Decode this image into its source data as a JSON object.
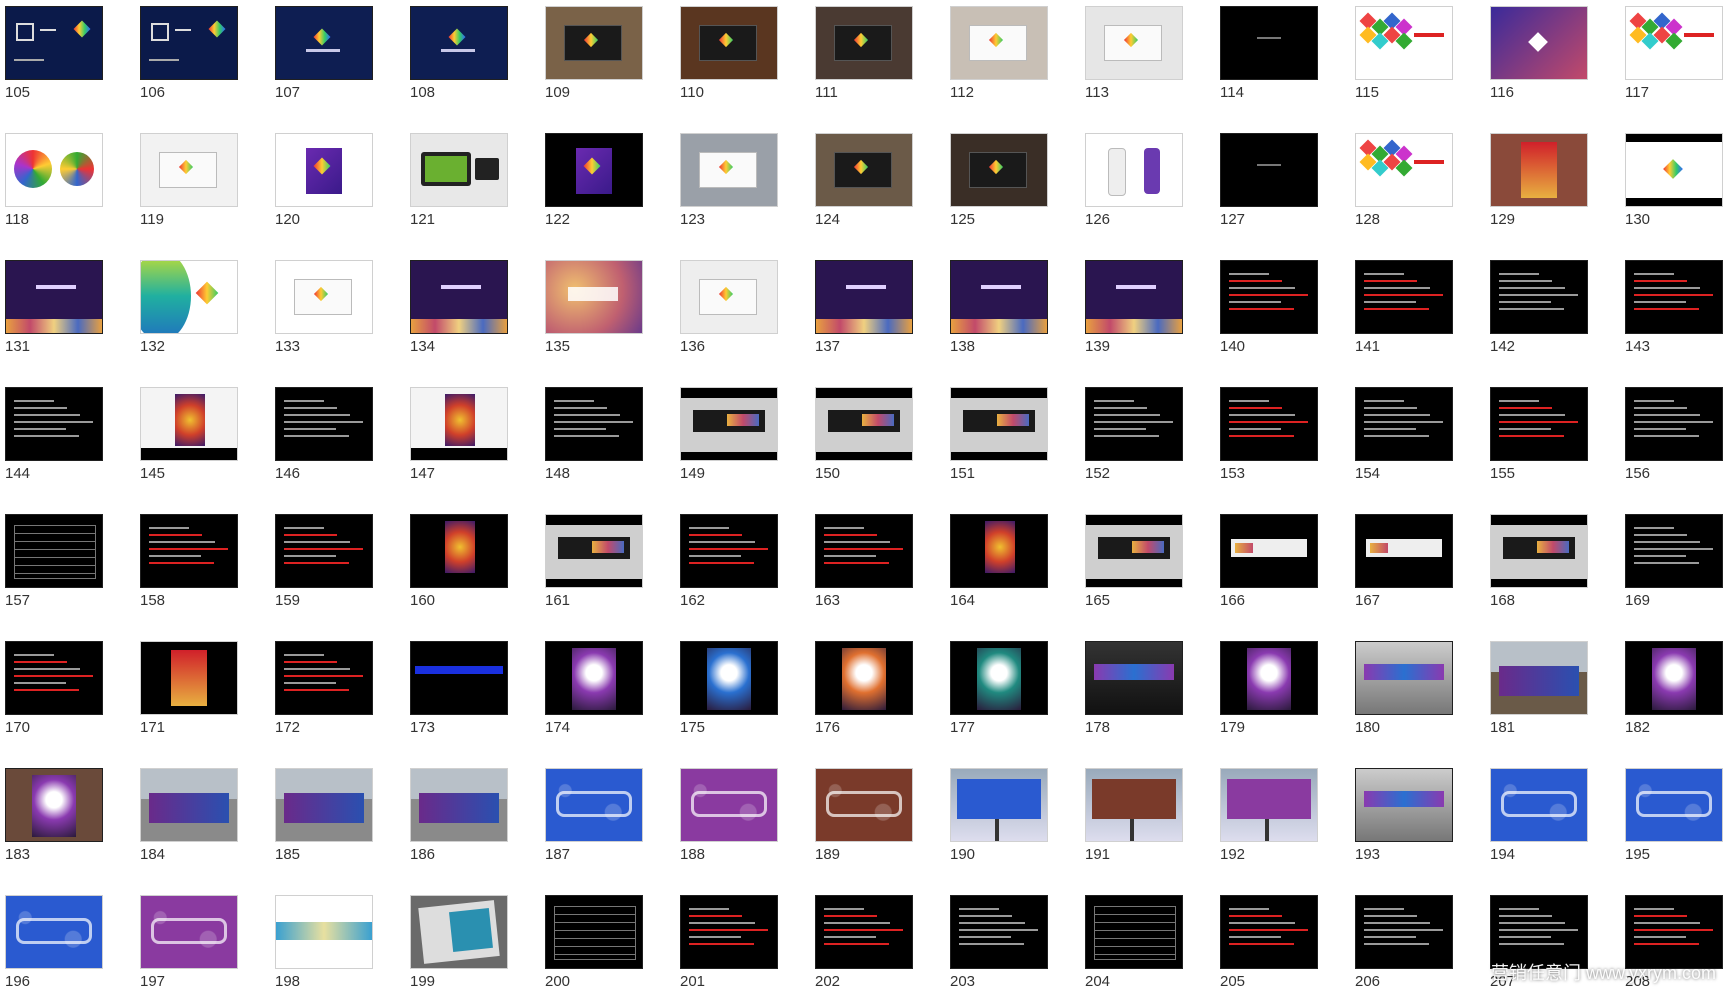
{
  "slides": [
    {
      "n": "105",
      "bg": "#0b1a4a",
      "style": "brand-dark"
    },
    {
      "n": "106",
      "bg": "#0b1a4a",
      "style": "brand-dark"
    },
    {
      "n": "107",
      "bg": "#0e1e52",
      "style": "navy"
    },
    {
      "n": "108",
      "bg": "#0e1e52",
      "style": "navy-logo"
    },
    {
      "n": "109",
      "bg": "#7a6248",
      "style": "photo-brown"
    },
    {
      "n": "110",
      "bg": "#5a3620",
      "style": "photo-brown"
    },
    {
      "n": "111",
      "bg": "#4a3a32",
      "style": "photo-brown"
    },
    {
      "n": "112",
      "bg": "#c8bfb5",
      "style": "photo-light"
    },
    {
      "n": "113",
      "bg": "#e6e6e6",
      "style": "photo-light"
    },
    {
      "n": "114",
      "bg": "#000000",
      "style": "black"
    },
    {
      "n": "115",
      "bg": "#ffffff",
      "style": "diamonds"
    },
    {
      "n": "116",
      "bg": "#5a3aa0",
      "style": "gradient"
    },
    {
      "n": "117",
      "bg": "#ffffff",
      "style": "diamonds"
    },
    {
      "n": "118",
      "bg": "#ffffff",
      "style": "umbrellas"
    },
    {
      "n": "119",
      "bg": "#f2f2f2",
      "style": "photo-light"
    },
    {
      "n": "120",
      "bg": "#ffffff",
      "style": "bag"
    },
    {
      "n": "121",
      "bg": "#e8e8e8",
      "style": "tablet"
    },
    {
      "n": "122",
      "bg": "#000000",
      "style": "bag-dark"
    },
    {
      "n": "123",
      "bg": "#9aa0a8",
      "style": "photo-light"
    },
    {
      "n": "124",
      "bg": "#6b5a48",
      "style": "photo-brown"
    },
    {
      "n": "125",
      "bg": "#3a2e26",
      "style": "photo-brown"
    },
    {
      "n": "126",
      "bg": "#ffffff",
      "style": "bottles"
    },
    {
      "n": "127",
      "bg": "#000000",
      "style": "black"
    },
    {
      "n": "128",
      "bg": "#ffffff",
      "style": "diamonds"
    },
    {
      "n": "129",
      "bg": "#8a4a3a",
      "style": "photo-red"
    },
    {
      "n": "130",
      "bg": "#ffffff",
      "style": "white-band"
    },
    {
      "n": "131",
      "bg": "#2a1550",
      "style": "purple-city"
    },
    {
      "n": "132",
      "bg": "#ffffff",
      "style": "swoosh"
    },
    {
      "n": "133",
      "bg": "#ffffff",
      "style": "photo-light"
    },
    {
      "n": "134",
      "bg": "#2a1550",
      "style": "purple-city"
    },
    {
      "n": "135",
      "bg": "#d08a40",
      "style": "bokeh"
    },
    {
      "n": "136",
      "bg": "#eeeeee",
      "style": "photo-light"
    },
    {
      "n": "137",
      "bg": "#2a1550",
      "style": "purple-city"
    },
    {
      "n": "138",
      "bg": "#2a1550",
      "style": "purple-city"
    },
    {
      "n": "139",
      "bg": "#2a1550",
      "style": "purple-city"
    },
    {
      "n": "140",
      "bg": "#000000",
      "style": "text-red"
    },
    {
      "n": "141",
      "bg": "#000000",
      "style": "text-red"
    },
    {
      "n": "142",
      "bg": "#000000",
      "style": "text"
    },
    {
      "n": "143",
      "bg": "#000000",
      "style": "text-red"
    },
    {
      "n": "144",
      "bg": "#000000",
      "style": "text"
    },
    {
      "n": "145",
      "bg": "#ffffff",
      "style": "poster-band"
    },
    {
      "n": "146",
      "bg": "#000000",
      "style": "text"
    },
    {
      "n": "147",
      "bg": "#ffffff",
      "style": "poster-band"
    },
    {
      "n": "148",
      "bg": "#000000",
      "style": "text"
    },
    {
      "n": "149",
      "bg": "#ffffff",
      "style": "banner-band"
    },
    {
      "n": "150",
      "bg": "#ffffff",
      "style": "billboard-band"
    },
    {
      "n": "151",
      "bg": "#ffffff",
      "style": "billboard-band"
    },
    {
      "n": "152",
      "bg": "#000000",
      "style": "text"
    },
    {
      "n": "153",
      "bg": "#000000",
      "style": "text-red"
    },
    {
      "n": "154",
      "bg": "#000000",
      "style": "text"
    },
    {
      "n": "155",
      "bg": "#000000",
      "style": "text-red"
    },
    {
      "n": "156",
      "bg": "#000000",
      "style": "text"
    },
    {
      "n": "157",
      "bg": "#000000",
      "style": "table"
    },
    {
      "n": "158",
      "bg": "#000000",
      "style": "text-red"
    },
    {
      "n": "159",
      "bg": "#000000",
      "style": "text-red"
    },
    {
      "n": "160",
      "bg": "#000000",
      "style": "poster-dark"
    },
    {
      "n": "161",
      "bg": "#ffffff",
      "style": "billboard-band"
    },
    {
      "n": "162",
      "bg": "#000000",
      "style": "text-red"
    },
    {
      "n": "163",
      "bg": "#000000",
      "style": "text-red"
    },
    {
      "n": "164",
      "bg": "#000000",
      "style": "poster-dark"
    },
    {
      "n": "165",
      "bg": "#ffffff",
      "style": "billboard-band"
    },
    {
      "n": "166",
      "bg": "#000000",
      "style": "banner-dark"
    },
    {
      "n": "167",
      "bg": "#000000",
      "style": "banner-dark"
    },
    {
      "n": "168",
      "bg": "#ffffff",
      "style": "billboard-band"
    },
    {
      "n": "169",
      "bg": "#000000",
      "style": "text"
    },
    {
      "n": "170",
      "bg": "#000000",
      "style": "text-red"
    },
    {
      "n": "171",
      "bg": "#000000",
      "style": "photo-red"
    },
    {
      "n": "172",
      "bg": "#000000",
      "style": "text-red"
    },
    {
      "n": "173",
      "bg": "#000000",
      "style": "blue-bar"
    },
    {
      "n": "174",
      "bg": "#000000",
      "style": "poster-purple"
    },
    {
      "n": "175",
      "bg": "#000000",
      "style": "poster-blue"
    },
    {
      "n": "176",
      "bg": "#000000",
      "style": "poster-orange"
    },
    {
      "n": "177",
      "bg": "#000000",
      "style": "poster-teal"
    },
    {
      "n": "178",
      "bg": "#1a1a1a",
      "style": "subway"
    },
    {
      "n": "179",
      "bg": "#000000",
      "style": "poster-purple"
    },
    {
      "n": "180",
      "bg": "#000000",
      "style": "mall"
    },
    {
      "n": "181",
      "bg": "#6a5a48",
      "style": "hello-wall"
    },
    {
      "n": "182",
      "bg": "#000000",
      "style": "poster-purple"
    },
    {
      "n": "183",
      "bg": "#6a4a3a",
      "style": "poster-purple"
    },
    {
      "n": "184",
      "bg": "#8a8a8a",
      "style": "bus-stop"
    },
    {
      "n": "185",
      "bg": "#8a8a8a",
      "style": "bus-stop"
    },
    {
      "n": "186",
      "bg": "#8a8a8a",
      "style": "bus-stop"
    },
    {
      "n": "187",
      "bg": "#1a4aa0",
      "style": "hello-blue"
    },
    {
      "n": "188",
      "bg": "#6a2a7a",
      "style": "hello-purple"
    },
    {
      "n": "189",
      "bg": "#5a2a1a",
      "style": "hello-brown"
    },
    {
      "n": "190",
      "bg": "#ffffff",
      "style": "billboard-blue"
    },
    {
      "n": "191",
      "bg": "#ffffff",
      "style": "billboard-brown"
    },
    {
      "n": "192",
      "bg": "#ffffff",
      "style": "billboard-purple"
    },
    {
      "n": "193",
      "bg": "#c0c0c0",
      "style": "mall"
    },
    {
      "n": "194",
      "bg": "#1a3a9a",
      "style": "hello-blue"
    },
    {
      "n": "195",
      "bg": "#1a4aa0",
      "style": "hello-blue"
    },
    {
      "n": "196",
      "bg": "#1a4aa0",
      "style": "hello-blue"
    },
    {
      "n": "197",
      "bg": "#6a2a7a",
      "style": "hello-purple"
    },
    {
      "n": "198",
      "bg": "#ffffff",
      "style": "strip"
    },
    {
      "n": "199",
      "bg": "#6a6a6a",
      "style": "newspaper"
    },
    {
      "n": "200",
      "bg": "#000000",
      "style": "table"
    },
    {
      "n": "201",
      "bg": "#000000",
      "style": "text-red"
    },
    {
      "n": "202",
      "bg": "#000000",
      "style": "text-red"
    },
    {
      "n": "203",
      "bg": "#000000",
      "style": "text"
    },
    {
      "n": "204",
      "bg": "#000000",
      "style": "table"
    },
    {
      "n": "205",
      "bg": "#000000",
      "style": "text-red"
    },
    {
      "n": "206",
      "bg": "#000000",
      "style": "text"
    },
    {
      "n": "207",
      "bg": "#000000",
      "style": "text"
    },
    {
      "n": "208",
      "bg": "#000000",
      "style": "text-red"
    }
  ],
  "watermark": "营销任意门 www.yxrym.com",
  "colors": {
    "label": "#333333",
    "brand_purple": "#5a2a8a",
    "brand_red": "#d0202a"
  }
}
